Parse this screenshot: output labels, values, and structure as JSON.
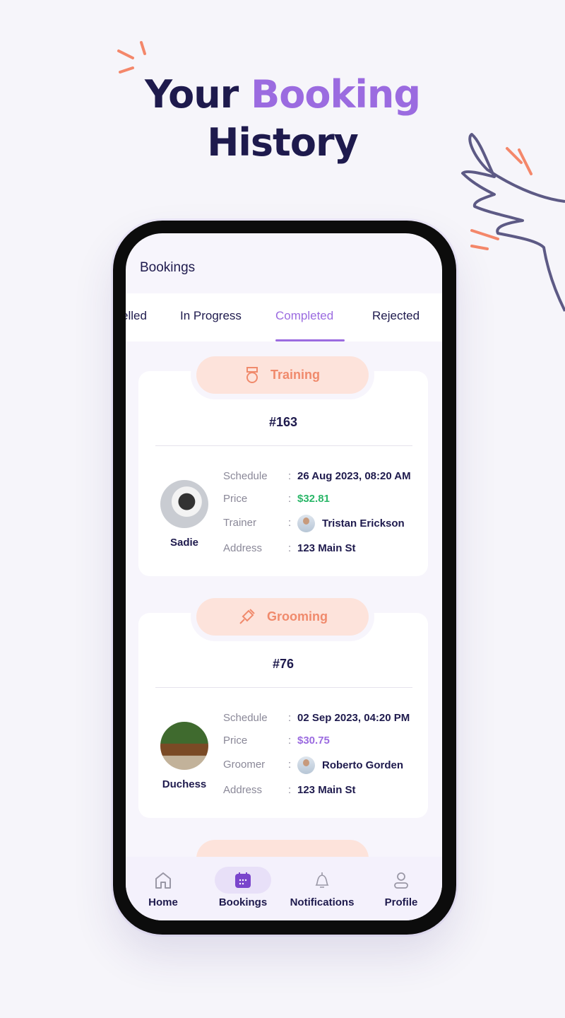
{
  "hero": {
    "title_part1": "Your",
    "title_accent": "Booking",
    "title_part2": "History"
  },
  "colors": {
    "accent": "#9b6be0",
    "navy": "#1e1a4d",
    "service_pill": "#fde3db",
    "service_text": "#f08a6c",
    "price_green": "#2bb769"
  },
  "screen": {
    "header": "Bookings"
  },
  "tabs": [
    {
      "label": "elled"
    },
    {
      "label": "In Progress"
    },
    {
      "label": "Completed",
      "active": true
    },
    {
      "label": "Rejected"
    }
  ],
  "bookings": [
    {
      "service": "Training",
      "service_icon": "medal-icon",
      "id": "#163",
      "pet": "Sadie",
      "rows": [
        {
          "label": "Schedule",
          "value": "26 Aug 2023, 08:20 AM"
        },
        {
          "label": "Price",
          "value": "$32.81",
          "color": "#2bb769"
        },
        {
          "label": "Trainer",
          "value": "Tristan Erickson"
        },
        {
          "label": "Address",
          "value": "123 Main St"
        }
      ]
    },
    {
      "service": "Grooming",
      "service_icon": "syringe-icon",
      "id": "#76",
      "pet": "Duchess",
      "rows": [
        {
          "label": "Schedule",
          "value": "02 Sep 2023, 04:20 PM"
        },
        {
          "label": "Price",
          "value": "$30.75",
          "color": "#9b6be0"
        },
        {
          "label": "Groomer",
          "value": "Roberto Gorden"
        },
        {
          "label": "Address",
          "value": "123 Main St"
        }
      ]
    }
  ],
  "nav": [
    {
      "label": "Home",
      "icon": "home-icon"
    },
    {
      "label": "Bookings",
      "icon": "calendar-icon",
      "active": true
    },
    {
      "label": "Notifications",
      "icon": "bell-icon"
    },
    {
      "label": "Profile",
      "icon": "user-icon"
    }
  ]
}
